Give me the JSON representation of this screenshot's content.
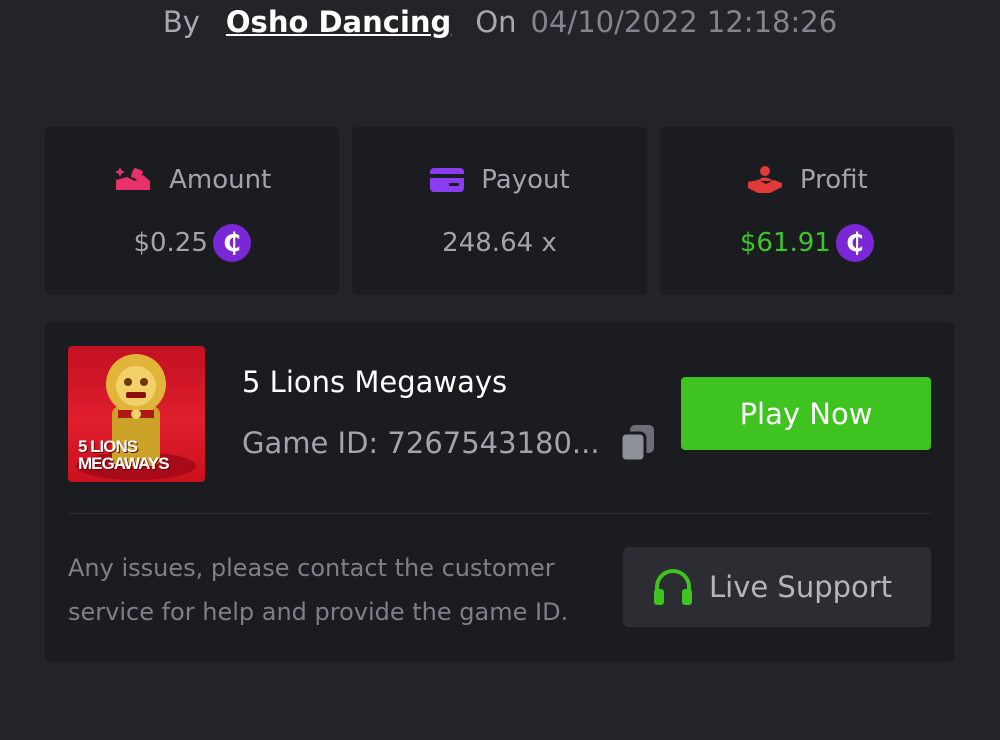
{
  "header": {
    "by_label": "By",
    "username": "Osho Dancing",
    "on_label": "On",
    "datetime": "04/10/2022 12:18:26"
  },
  "stats": {
    "amount": {
      "label": "Amount",
      "value": "$0.25",
      "icon": "hand-coin-icon",
      "coin": "₵"
    },
    "payout": {
      "label": "Payout",
      "value": "248.64 x",
      "icon": "credit-card-icon"
    },
    "profit": {
      "label": "Profit",
      "value": "$61.91",
      "icon": "hand-receive-icon",
      "coin": "₵"
    }
  },
  "game": {
    "name": "5 Lions Megaways",
    "thumbnail_text_line1": "5 LIONS",
    "thumbnail_text_line2": "MEGAWAYS",
    "game_id": "Game ID: 7267543180...",
    "play_label": "Play Now"
  },
  "support": {
    "message": "Any issues, please contact the customer service for help and provide the game ID.",
    "button_label": "Live Support",
    "icon": "headset-icon"
  },
  "colors": {
    "background": "#232428",
    "card": "#1b1c20",
    "accent_green": "#3ec320",
    "coin_purple": "#7a27d6",
    "amount_pink": "#e8306b",
    "payout_purple": "#8a3df0",
    "profit_red": "#e23a3a"
  }
}
